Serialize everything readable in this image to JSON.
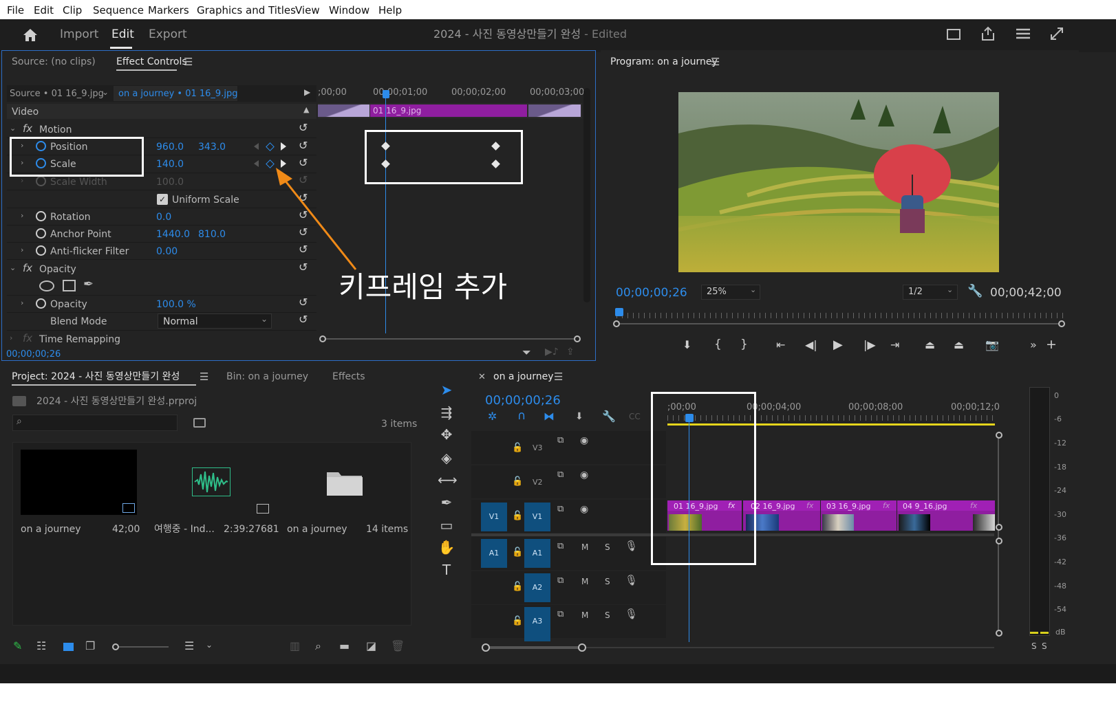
{
  "menubar": {
    "items": [
      "File",
      "Edit",
      "Clip",
      "Sequence",
      "Markers",
      "Graphics and Titles",
      "View",
      "Window",
      "Help"
    ]
  },
  "header": {
    "import": "Import",
    "edit": "Edit",
    "export": "Export",
    "title": "2024 - 사진 동영상만들기 완성",
    "edited": " - Edited"
  },
  "effect_controls": {
    "tab_source": "Source: (no clips)",
    "tab_effect": "Effect Controls",
    "source_label": "Source • 01 16_9.jpg",
    "clip_label": "on a journey • 01 16_9.jpg",
    "times": [
      ";00;00",
      "00;00;01;00",
      "00;00;02;00",
      "00;00;03;00"
    ],
    "clip_name": "01 16_9.jpg",
    "video": "Video",
    "motion": "Motion",
    "position": {
      "label": "Position",
      "x": "960.0",
      "y": "343.0"
    },
    "scale": {
      "label": "Scale",
      "v": "140.0"
    },
    "scale_width": {
      "label": "Scale Width",
      "v": "100.0"
    },
    "uniform": "Uniform Scale",
    "rotation": {
      "label": "Rotation",
      "v": "0.0"
    },
    "anchor": {
      "label": "Anchor Point",
      "x": "1440.0",
      "y": "810.0"
    },
    "antiflicker": {
      "label": "Anti-flicker Filter",
      "v": "0.00"
    },
    "opacity_section": "Opacity",
    "opacity": {
      "label": "Opacity",
      "v": "100.0 %"
    },
    "blend": {
      "label": "Blend Mode",
      "v": "Normal"
    },
    "time_remap": "Time Remapping",
    "timecode": "00;00;00;26",
    "annotation": "키프레임 추가"
  },
  "program": {
    "title": "Program: on a journey",
    "timecode": "00;00;00;26",
    "zoom": "25%",
    "res": "1/2",
    "duration": "00;00;42;00"
  },
  "project": {
    "tab_project": "Project: 2024 - 사진 동영상만들기 완성",
    "tab_bin": "Bin: on a journey",
    "tab_effects": "Effects",
    "file": "2024 - 사진 동영상만들기 완성.prproj",
    "count": "3 items",
    "items": [
      {
        "name": "on a journey",
        "meta": "42;00"
      },
      {
        "name": "여행중 - Ind...",
        "meta": "2:39:27681"
      },
      {
        "name": "on a journey",
        "meta": "14 items"
      }
    ]
  },
  "timeline": {
    "tab": "on a journey",
    "timecode": "00;00;00;26",
    "ruler": [
      ";00;00",
      "00;00;04;00",
      "00;00;08;00",
      "00;00;12;0"
    ],
    "tracks": {
      "v3": "V3",
      "v2": "V2",
      "v1": "V1",
      "a1": "A1",
      "a2": "A2",
      "a3": "A3",
      "m": "M",
      "s": "S"
    },
    "clips": [
      "01 16_9.jpg",
      "02 16_9.jpg",
      "03 16_9.jpg",
      "04 9_16.jpg"
    ],
    "fx": "fx"
  },
  "meter": {
    "labels": [
      "0",
      "-6",
      "-12",
      "-18",
      "-24",
      "-30",
      "-36",
      "-42",
      "-48",
      "-54",
      "dB"
    ],
    "solo": "S"
  }
}
